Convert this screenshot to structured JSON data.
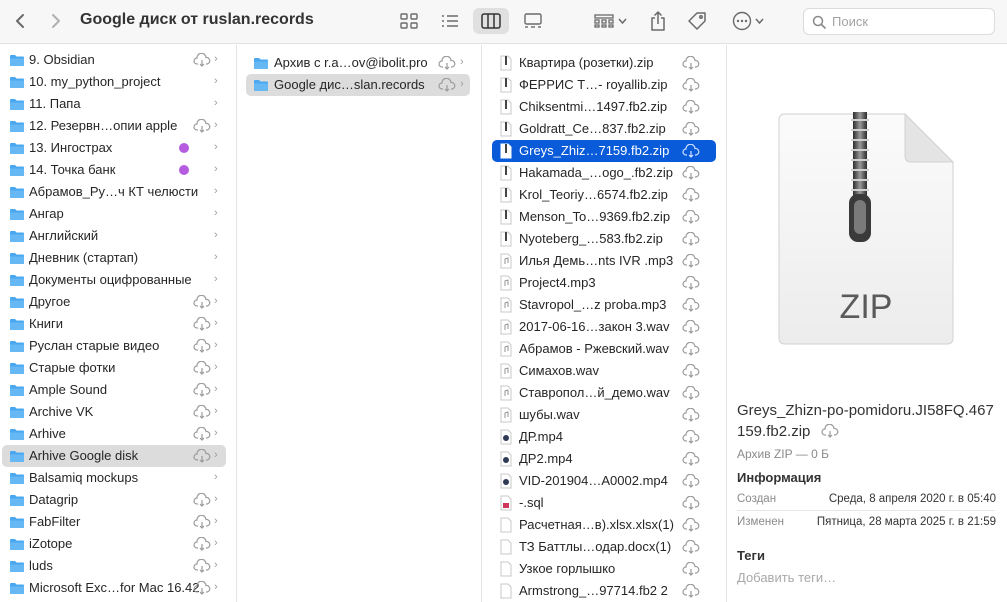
{
  "window": {
    "title": "Google диск от ruslan.records"
  },
  "search": {
    "placeholder": "Поиск"
  },
  "column1": {
    "items": [
      {
        "label": "9. Obsidian",
        "cloud": true,
        "dot": false
      },
      {
        "label": "10. my_python_project",
        "cloud": false,
        "dot": false
      },
      {
        "label": "11. Папа",
        "cloud": false,
        "dot": false
      },
      {
        "label": "12. Резервн…опии apple",
        "cloud": true,
        "dot": false
      },
      {
        "label": "13. Ингострах",
        "cloud": false,
        "dot": true
      },
      {
        "label": "14. Точка банк",
        "cloud": false,
        "dot": true
      },
      {
        "label": "Абрамов_Ру…ч КТ челюсти",
        "cloud": false,
        "dot": false
      },
      {
        "label": "Ангар",
        "cloud": false,
        "dot": false
      },
      {
        "label": "Английский",
        "cloud": false,
        "dot": false
      },
      {
        "label": "Дневник (стартап)",
        "cloud": false,
        "dot": false
      },
      {
        "label": "Документы оцифрованные",
        "cloud": false,
        "dot": false
      },
      {
        "label": "Другое",
        "cloud": true,
        "dot": false
      },
      {
        "label": "Книги",
        "cloud": true,
        "dot": false
      },
      {
        "label": "Руслан старые видео",
        "cloud": true,
        "dot": false
      },
      {
        "label": "Старые фотки",
        "cloud": true,
        "dot": false
      },
      {
        "label": "Ample Sound",
        "cloud": true,
        "dot": false
      },
      {
        "label": "Archive VK",
        "cloud": true,
        "dot": false
      },
      {
        "label": "Arhive",
        "cloud": true,
        "dot": false
      },
      {
        "label": "Arhive Google disk",
        "cloud": true,
        "dot": false,
        "selected": true
      },
      {
        "label": "Balsamiq mockups",
        "cloud": false,
        "dot": false
      },
      {
        "label": "Datagrip",
        "cloud": true,
        "dot": false
      },
      {
        "label": "FabFilter",
        "cloud": true,
        "dot": false
      },
      {
        "label": "iZotope",
        "cloud": true,
        "dot": false
      },
      {
        "label": "luds",
        "cloud": true,
        "dot": false
      },
      {
        "label": "Microsoft Exc…for Mac 16.42",
        "cloud": true,
        "dot": false
      }
    ]
  },
  "column2": {
    "items": [
      {
        "label": "Архив с r.a…ov@ibolit.pro"
      },
      {
        "label": "Google дис…slan.records",
        "selected": true
      }
    ]
  },
  "column3": {
    "items": [
      {
        "label": "Квартира (розетки).zip",
        "kind": "zip"
      },
      {
        "label": "ФЕРРИС Т…- royallib.zip",
        "kind": "zip"
      },
      {
        "label": "Chiksentmi…1497.fb2.zip",
        "kind": "zip"
      },
      {
        "label": "Goldratt_Ce…837.fb2.zip",
        "kind": "zip"
      },
      {
        "label": "Greys_Zhiz…7159.fb2.zip",
        "kind": "zip",
        "selected": true
      },
      {
        "label": "Hakamada_…ogo_.fb2.zip",
        "kind": "zip"
      },
      {
        "label": "Krol_Teoriy…6574.fb2.zip",
        "kind": "zip"
      },
      {
        "label": "Menson_To…9369.fb2.zip",
        "kind": "zip"
      },
      {
        "label": "Nyoteberg_…583.fb2.zip",
        "kind": "zip"
      },
      {
        "label": "Илья Демь…nts IVR .mp3",
        "kind": "audio"
      },
      {
        "label": "Project4.mp3",
        "kind": "audio"
      },
      {
        "label": "Stavropol_…z proba.mp3",
        "kind": "audio"
      },
      {
        "label": "2017-06-16…закон 3.wav",
        "kind": "audio"
      },
      {
        "label": "Абрамов - Ржевский.wav",
        "kind": "audio"
      },
      {
        "label": "Симахов.wav",
        "kind": "audio"
      },
      {
        "label": "Ставропол…й_демо.wav",
        "kind": "audio"
      },
      {
        "label": "шубы.wav",
        "kind": "audio"
      },
      {
        "label": "ДР.mp4",
        "kind": "video"
      },
      {
        "label": "ДР2.mp4",
        "kind": "video"
      },
      {
        "label": "VID-201904…A0002.mp4",
        "kind": "video"
      },
      {
        "label": "-.sql",
        "kind": "sql"
      },
      {
        "label": "Расчетная…в).xlsx.xlsx(1)",
        "kind": "doc"
      },
      {
        "label": "ТЗ Баттлы…одар.docx(1)",
        "kind": "doc"
      },
      {
        "label": "Узкое горлышко",
        "kind": "doc"
      },
      {
        "label": "Armstrong_…97714.fb2 2",
        "kind": "doc"
      }
    ]
  },
  "preview": {
    "badge": "ZIP",
    "filename": "Greys_Zhizn-po-pomidoru.JI58FQ.467159.fb2.zip",
    "kind": "Архив ZIP — 0 Б",
    "info_heading": "Информация",
    "created_label": "Создан",
    "created_value": "Среда, 8 апреля 2020 г. в 05:40",
    "modified_label": "Изменен",
    "modified_value": "Пятница, 28 марта 2025 г. в 21:59",
    "tags_heading": "Теги",
    "tags_placeholder": "Добавить теги…"
  },
  "colors": {
    "folder": "#4aa8f0",
    "selection": "#0a5bd9",
    "tag_dot": "#b65ce0"
  }
}
